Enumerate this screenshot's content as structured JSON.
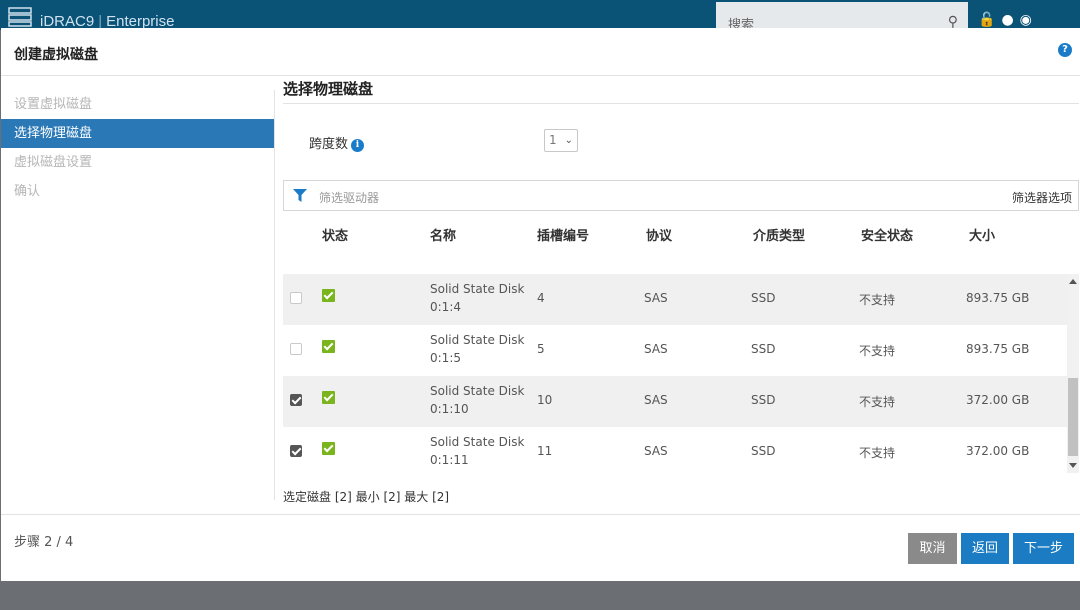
{
  "app": {
    "title": "iDRAC9",
    "edition": "Enterprise",
    "search_placeholder": "搜索"
  },
  "modal": {
    "title": "创建虚拟磁盘",
    "help_icon": "?"
  },
  "steps": [
    {
      "label": "设置虚拟磁盘",
      "state": "done"
    },
    {
      "label": "选择物理磁盘",
      "state": "active"
    },
    {
      "label": "虚拟磁盘设置",
      "state": "pending"
    },
    {
      "label": "确认",
      "state": "pending"
    }
  ],
  "content": {
    "section_title": "选择物理磁盘",
    "span_label": "跨度数",
    "info_icon": "i",
    "span_value": "1",
    "filter_placeholder": "筛选驱动器",
    "filter_options": "筛选器选项"
  },
  "table": {
    "headers": [
      "状态",
      "名称",
      "插槽编号",
      "协议",
      "介质类型",
      "安全状态",
      "大小"
    ],
    "rows": [
      {
        "selected": false,
        "name_line1": "Solid State Disk",
        "name_line2": "0:1:4",
        "slot": "4",
        "protocol": "SAS",
        "media": "SSD",
        "security": "不支持",
        "size": "893.75 GB"
      },
      {
        "selected": false,
        "name_line1": "Solid State Disk",
        "name_line2": "0:1:5",
        "slot": "5",
        "protocol": "SAS",
        "media": "SSD",
        "security": "不支持",
        "size": "893.75 GB"
      },
      {
        "selected": true,
        "name_line1": "Solid State Disk",
        "name_line2": "0:1:10",
        "slot": "10",
        "protocol": "SAS",
        "media": "SSD",
        "security": "不支持",
        "size": "372.00 GB"
      },
      {
        "selected": true,
        "name_line1": "Solid State Disk",
        "name_line2": "0:1:11",
        "slot": "11",
        "protocol": "SAS",
        "media": "SSD",
        "security": "不支持",
        "size": "372.00 GB"
      }
    ]
  },
  "selection_summary": "选定磁盘 [2] 最小 [2] 最大 [2]",
  "footer": {
    "step_count": "步骤 2 / 4",
    "cancel": "取消",
    "back": "返回",
    "next": "下一步"
  },
  "colors": {
    "header_bg": "#0b5277",
    "active_step": "#2b78b6",
    "primary_button": "#1b7cc3",
    "cancel_button": "#8a8a8a",
    "status_ok": "#7ab51d"
  }
}
